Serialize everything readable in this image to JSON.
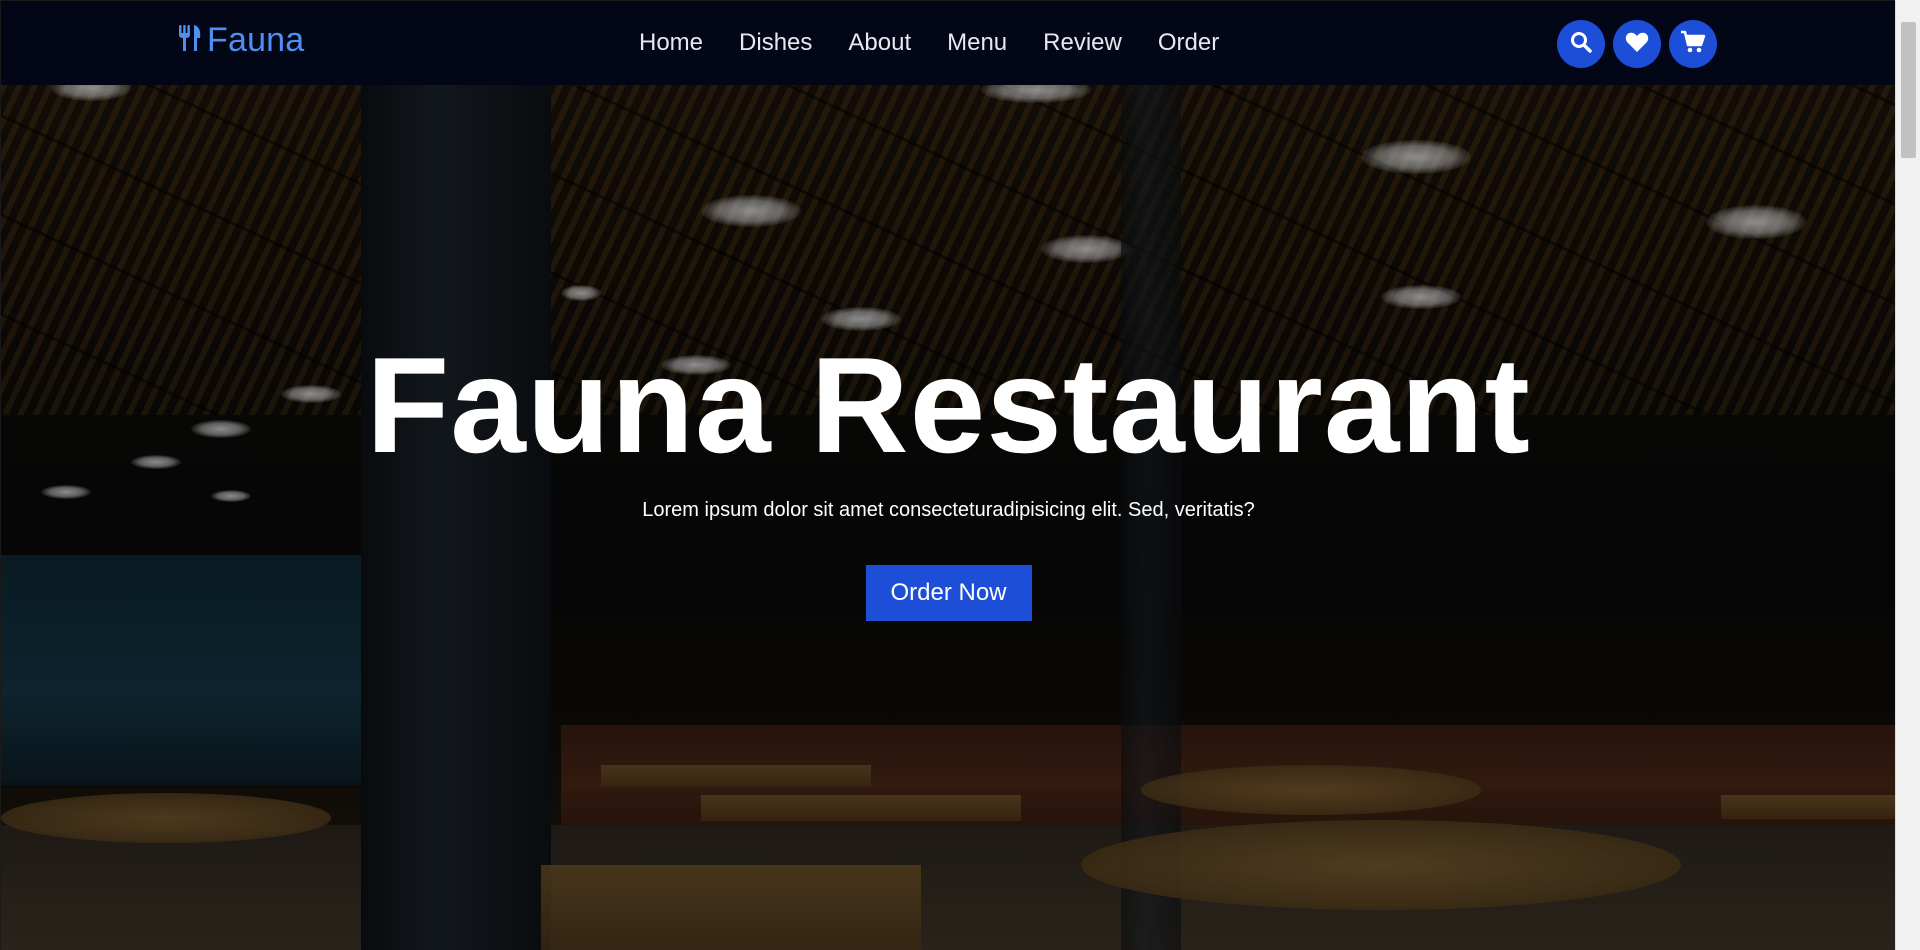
{
  "brand": {
    "name": "Fauna",
    "icon": "utensils-icon",
    "color": "#4f8ff0"
  },
  "nav": {
    "items": [
      {
        "label": "Home"
      },
      {
        "label": "Dishes"
      },
      {
        "label": "About"
      },
      {
        "label": "Menu"
      },
      {
        "label": "Review"
      },
      {
        "label": "Order"
      }
    ]
  },
  "header_icons": [
    {
      "name": "search-icon"
    },
    {
      "name": "heart-icon"
    },
    {
      "name": "cart-icon"
    }
  ],
  "hero": {
    "title": "Fauna Restaurant",
    "subtitle": "Lorem ipsum dolor sit amet consecteturadipisicing elit. Sed, veritatis?",
    "cta_label": "Order Now"
  },
  "colors": {
    "header_bg": "#020617",
    "accent": "#1d4ed8",
    "text": "#ffffff"
  }
}
